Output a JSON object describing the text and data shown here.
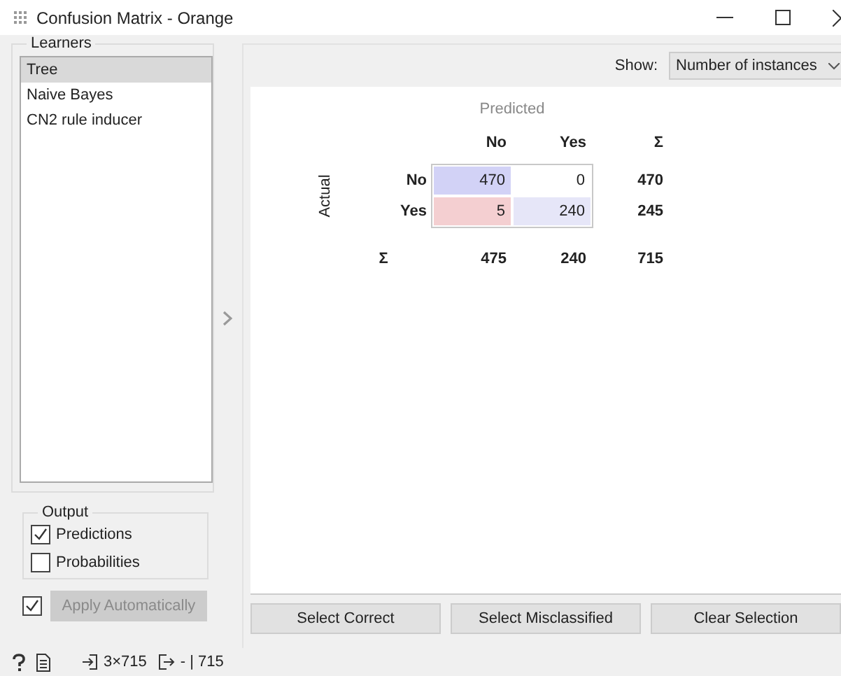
{
  "window": {
    "title": "Confusion Matrix - Orange"
  },
  "learners": {
    "title": "Learners",
    "items": [
      {
        "label": "Tree",
        "selected": true
      },
      {
        "label": "Naive Bayes",
        "selected": false
      },
      {
        "label": "CN2 rule inducer",
        "selected": false
      }
    ]
  },
  "output": {
    "title": "Output",
    "options": [
      {
        "label": "Predictions",
        "checked": true
      },
      {
        "label": "Probabilities",
        "checked": false
      }
    ]
  },
  "apply": {
    "label": "Apply Automatically",
    "checked": true,
    "disabled": true
  },
  "show": {
    "label": "Show:",
    "value": "Number of instances"
  },
  "matrix": {
    "predicted_label": "Predicted",
    "actual_label": "Actual",
    "columns": [
      "No",
      "Yes",
      "Σ"
    ],
    "rows": [
      {
        "label": "No",
        "cells": [
          {
            "value": "470",
            "color": "#d2d2f6"
          },
          {
            "value": "0",
            "color": "#ffffff"
          }
        ],
        "total": "470"
      },
      {
        "label": "Yes",
        "cells": [
          {
            "value": "5",
            "color": "#f4cfd1"
          },
          {
            "value": "240",
            "color": "#e6e6f8"
          }
        ],
        "total": "245"
      }
    ],
    "totals_label": "Σ",
    "totals": [
      "475",
      "240",
      "715"
    ]
  },
  "buttons": [
    "Select Correct",
    "Select Misclassified",
    "Clear Selection"
  ],
  "status": {
    "input": "3×715",
    "output": "- | 715"
  }
}
